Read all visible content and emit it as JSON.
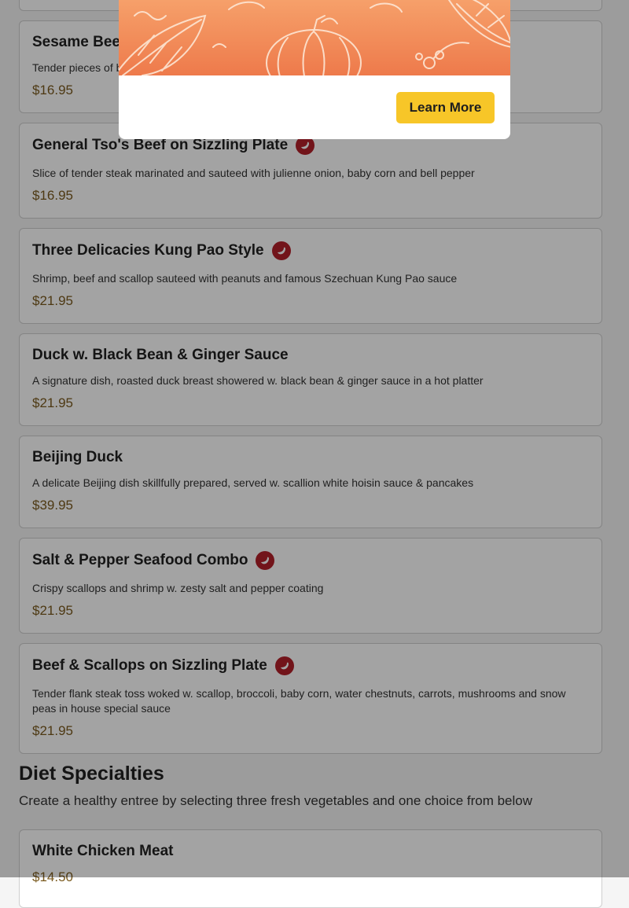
{
  "dishes": [
    {
      "title": "Sesame Beef",
      "desc": "Tender pieces of beef",
      "price": "$16.95",
      "spicy": false
    },
    {
      "title": "General Tso's Beef on Sizzling Plate",
      "desc": "Slice of tender steak marinated and sauteed with julienne onion, baby corn and bell pepper",
      "price": "$16.95",
      "spicy": true
    },
    {
      "title": "Three Delicacies Kung Pao Style",
      "desc": "Shrimp, beef and scallop sauteed with peanuts and famous Szechuan Kung Pao sauce",
      "price": "$21.95",
      "spicy": true
    },
    {
      "title": "Duck w. Black Bean & Ginger Sauce",
      "desc": "A signature dish, roasted duck breast showered w. black bean & ginger sauce in a hot platter",
      "price": "$21.95",
      "spicy": false
    },
    {
      "title": "Beijing Duck",
      "desc": "A delicate Beijing dish skillfully prepared, served w. scallion white hoisin sauce & pancakes",
      "price": "$39.95",
      "spicy": false
    },
    {
      "title": "Salt & Pepper Seafood Combo",
      "desc": "Crispy scallops and shrimp w. zesty salt and pepper coating",
      "price": "$21.95",
      "spicy": true
    },
    {
      "title": "Beef & Scallops on Sizzling Plate",
      "desc": "Tender flank steak toss woked w. scallop, broccoli, baby corn, water chestnuts, carrots, mushrooms and snow peas in house special sauce",
      "price": "$21.95",
      "spicy": true
    }
  ],
  "diet_section": {
    "title": "Diet Specialties",
    "desc": "Create a healthy entree by selecting three fresh vegetables and one choice from below",
    "items": [
      {
        "title": "White Chicken Meat",
        "price": "$14.50"
      }
    ]
  },
  "modal": {
    "learn_more_label": "Learn More"
  },
  "icons": {
    "spicy": "chili-pepper-icon"
  },
  "colors": {
    "accent_button": "#f7c628",
    "spicy_badge": "#b3202a",
    "banner": "#ee7a4b",
    "price": "#7a5a1e"
  }
}
